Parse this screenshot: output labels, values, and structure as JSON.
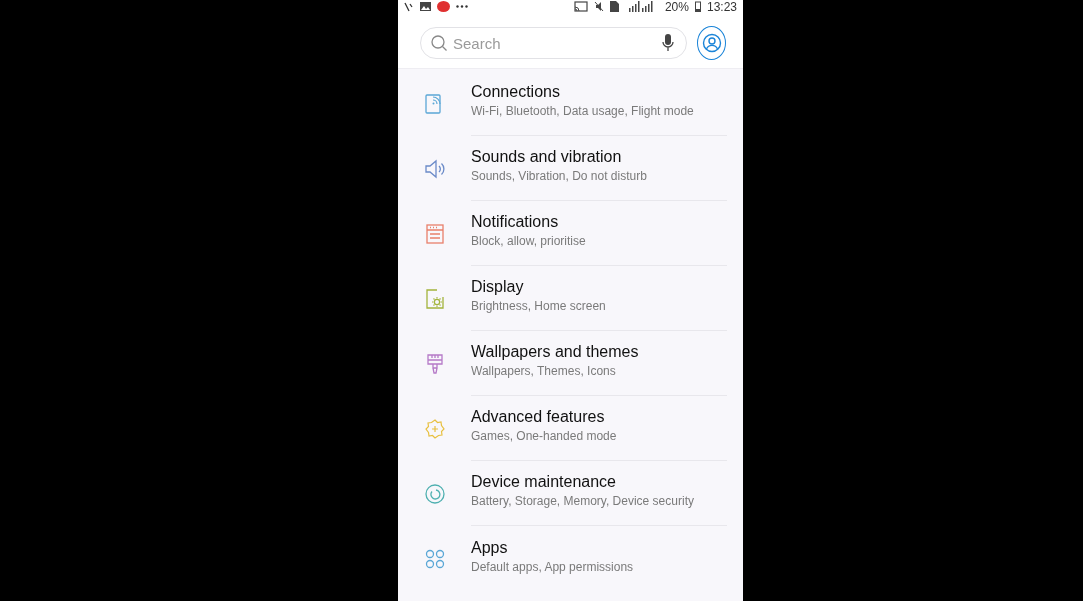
{
  "status_bar": {
    "battery": "20%",
    "time": "13:23"
  },
  "search": {
    "placeholder": "Search"
  },
  "items": [
    {
      "title": "Connections",
      "subtitle": "Wi-Fi, Bluetooth, Data usage, Flight mode"
    },
    {
      "title": "Sounds and vibration",
      "subtitle": "Sounds, Vibration, Do not disturb"
    },
    {
      "title": "Notifications",
      "subtitle": "Block, allow, prioritise"
    },
    {
      "title": "Display",
      "subtitle": "Brightness, Home screen"
    },
    {
      "title": "Wallpapers and themes",
      "subtitle": "Wallpapers, Themes, Icons"
    },
    {
      "title": "Advanced features",
      "subtitle": "Games, One-handed mode"
    },
    {
      "title": "Device maintenance",
      "subtitle": "Battery, Storage, Memory, Device security"
    },
    {
      "title": "Apps",
      "subtitle": "Default apps, App permissions"
    }
  ]
}
